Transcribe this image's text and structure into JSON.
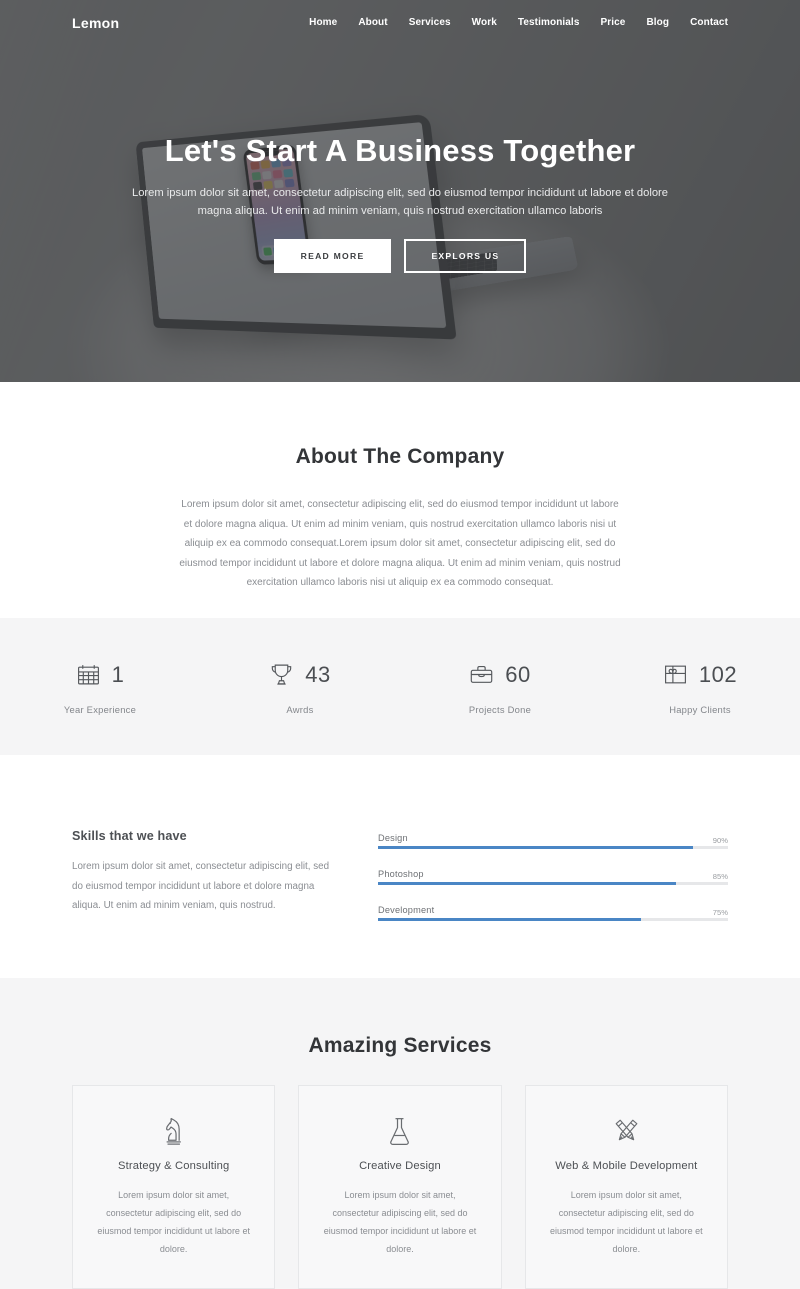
{
  "nav": {
    "brand": "Lemon",
    "links": [
      {
        "label": "Home"
      },
      {
        "label": "About"
      },
      {
        "label": "Services"
      },
      {
        "label": "Work"
      },
      {
        "label": "Testimonials"
      },
      {
        "label": "Price"
      },
      {
        "label": "Blog"
      },
      {
        "label": "Contact"
      }
    ]
  },
  "hero": {
    "title": "Let's Start A Business Together",
    "subtitle": "Lorem ipsum dolor sit amet, consectetur adipiscing elit, sed do eiusmod tempor incididunt ut labore et dolore magna aliqua. Ut enim ad minim veniam, quis nostrud exercitation ullamco laboris",
    "primary_button": "READ MORE",
    "secondary_button": "EXPLORS US"
  },
  "about": {
    "title": "About The Company",
    "body": "Lorem ipsum dolor sit amet, consectetur adipiscing elit, sed do eiusmod tempor incididunt ut labore et dolore magna aliqua. Ut enim ad minim veniam, quis nostrud exercitation ullamco laboris nisi ut aliquip ex ea commodo consequat.Lorem ipsum dolor sit amet, consectetur adipiscing elit, sed do eiusmod tempor incididunt ut labore et dolore magna aliqua. Ut enim ad minim veniam, quis nostrud exercitation ullamco laboris nisi ut aliquip ex ea commodo consequat."
  },
  "stats": {
    "items": [
      {
        "icon": "calendar-icon",
        "value": "1",
        "label": "Year Experience"
      },
      {
        "icon": "trophy-icon",
        "value": "43",
        "label": "Awrds"
      },
      {
        "icon": "briefcase-icon",
        "value": "60",
        "label": "Projects Done"
      },
      {
        "icon": "gift-icon",
        "value": "102",
        "label": "Happy Clients"
      }
    ]
  },
  "skills": {
    "heading": "Skills that we have",
    "body": "Lorem ipsum dolor sit amet, consectetur adipiscing elit, sed do eiusmod tempor incididunt ut labore et dolore magna aliqua. Ut enim ad minim veniam, quis nostrud.",
    "bar_color": "#4a86c5",
    "track_color": "#e6e7e9",
    "items": [
      {
        "name": "Design",
        "percent_label": "90%",
        "percent": 90
      },
      {
        "name": "Photoshop",
        "percent_label": "85%",
        "percent": 85
      },
      {
        "name": "Development",
        "percent_label": "75%",
        "percent": 75
      }
    ]
  },
  "services": {
    "title": "Amazing Services",
    "cards": [
      {
        "icon": "chess-knight-icon",
        "title": "Strategy & Consulting",
        "body": "Lorem ipsum dolor sit amet, consectetur adipiscing elit, sed do eiusmod tempor incididunt ut labore et dolore."
      },
      {
        "icon": "flask-icon",
        "title": "Creative Design",
        "body": "Lorem ipsum dolor sit amet, consectetur adipiscing elit, sed do eiusmod tempor incididunt ut labore et dolore."
      },
      {
        "icon": "crossed-pencils-icon",
        "title": "Web & Mobile Development",
        "body": "Lorem ipsum dolor sit amet, consectetur adipiscing elit, sed do eiusmod tempor incididunt ut labore et dolore."
      }
    ]
  }
}
